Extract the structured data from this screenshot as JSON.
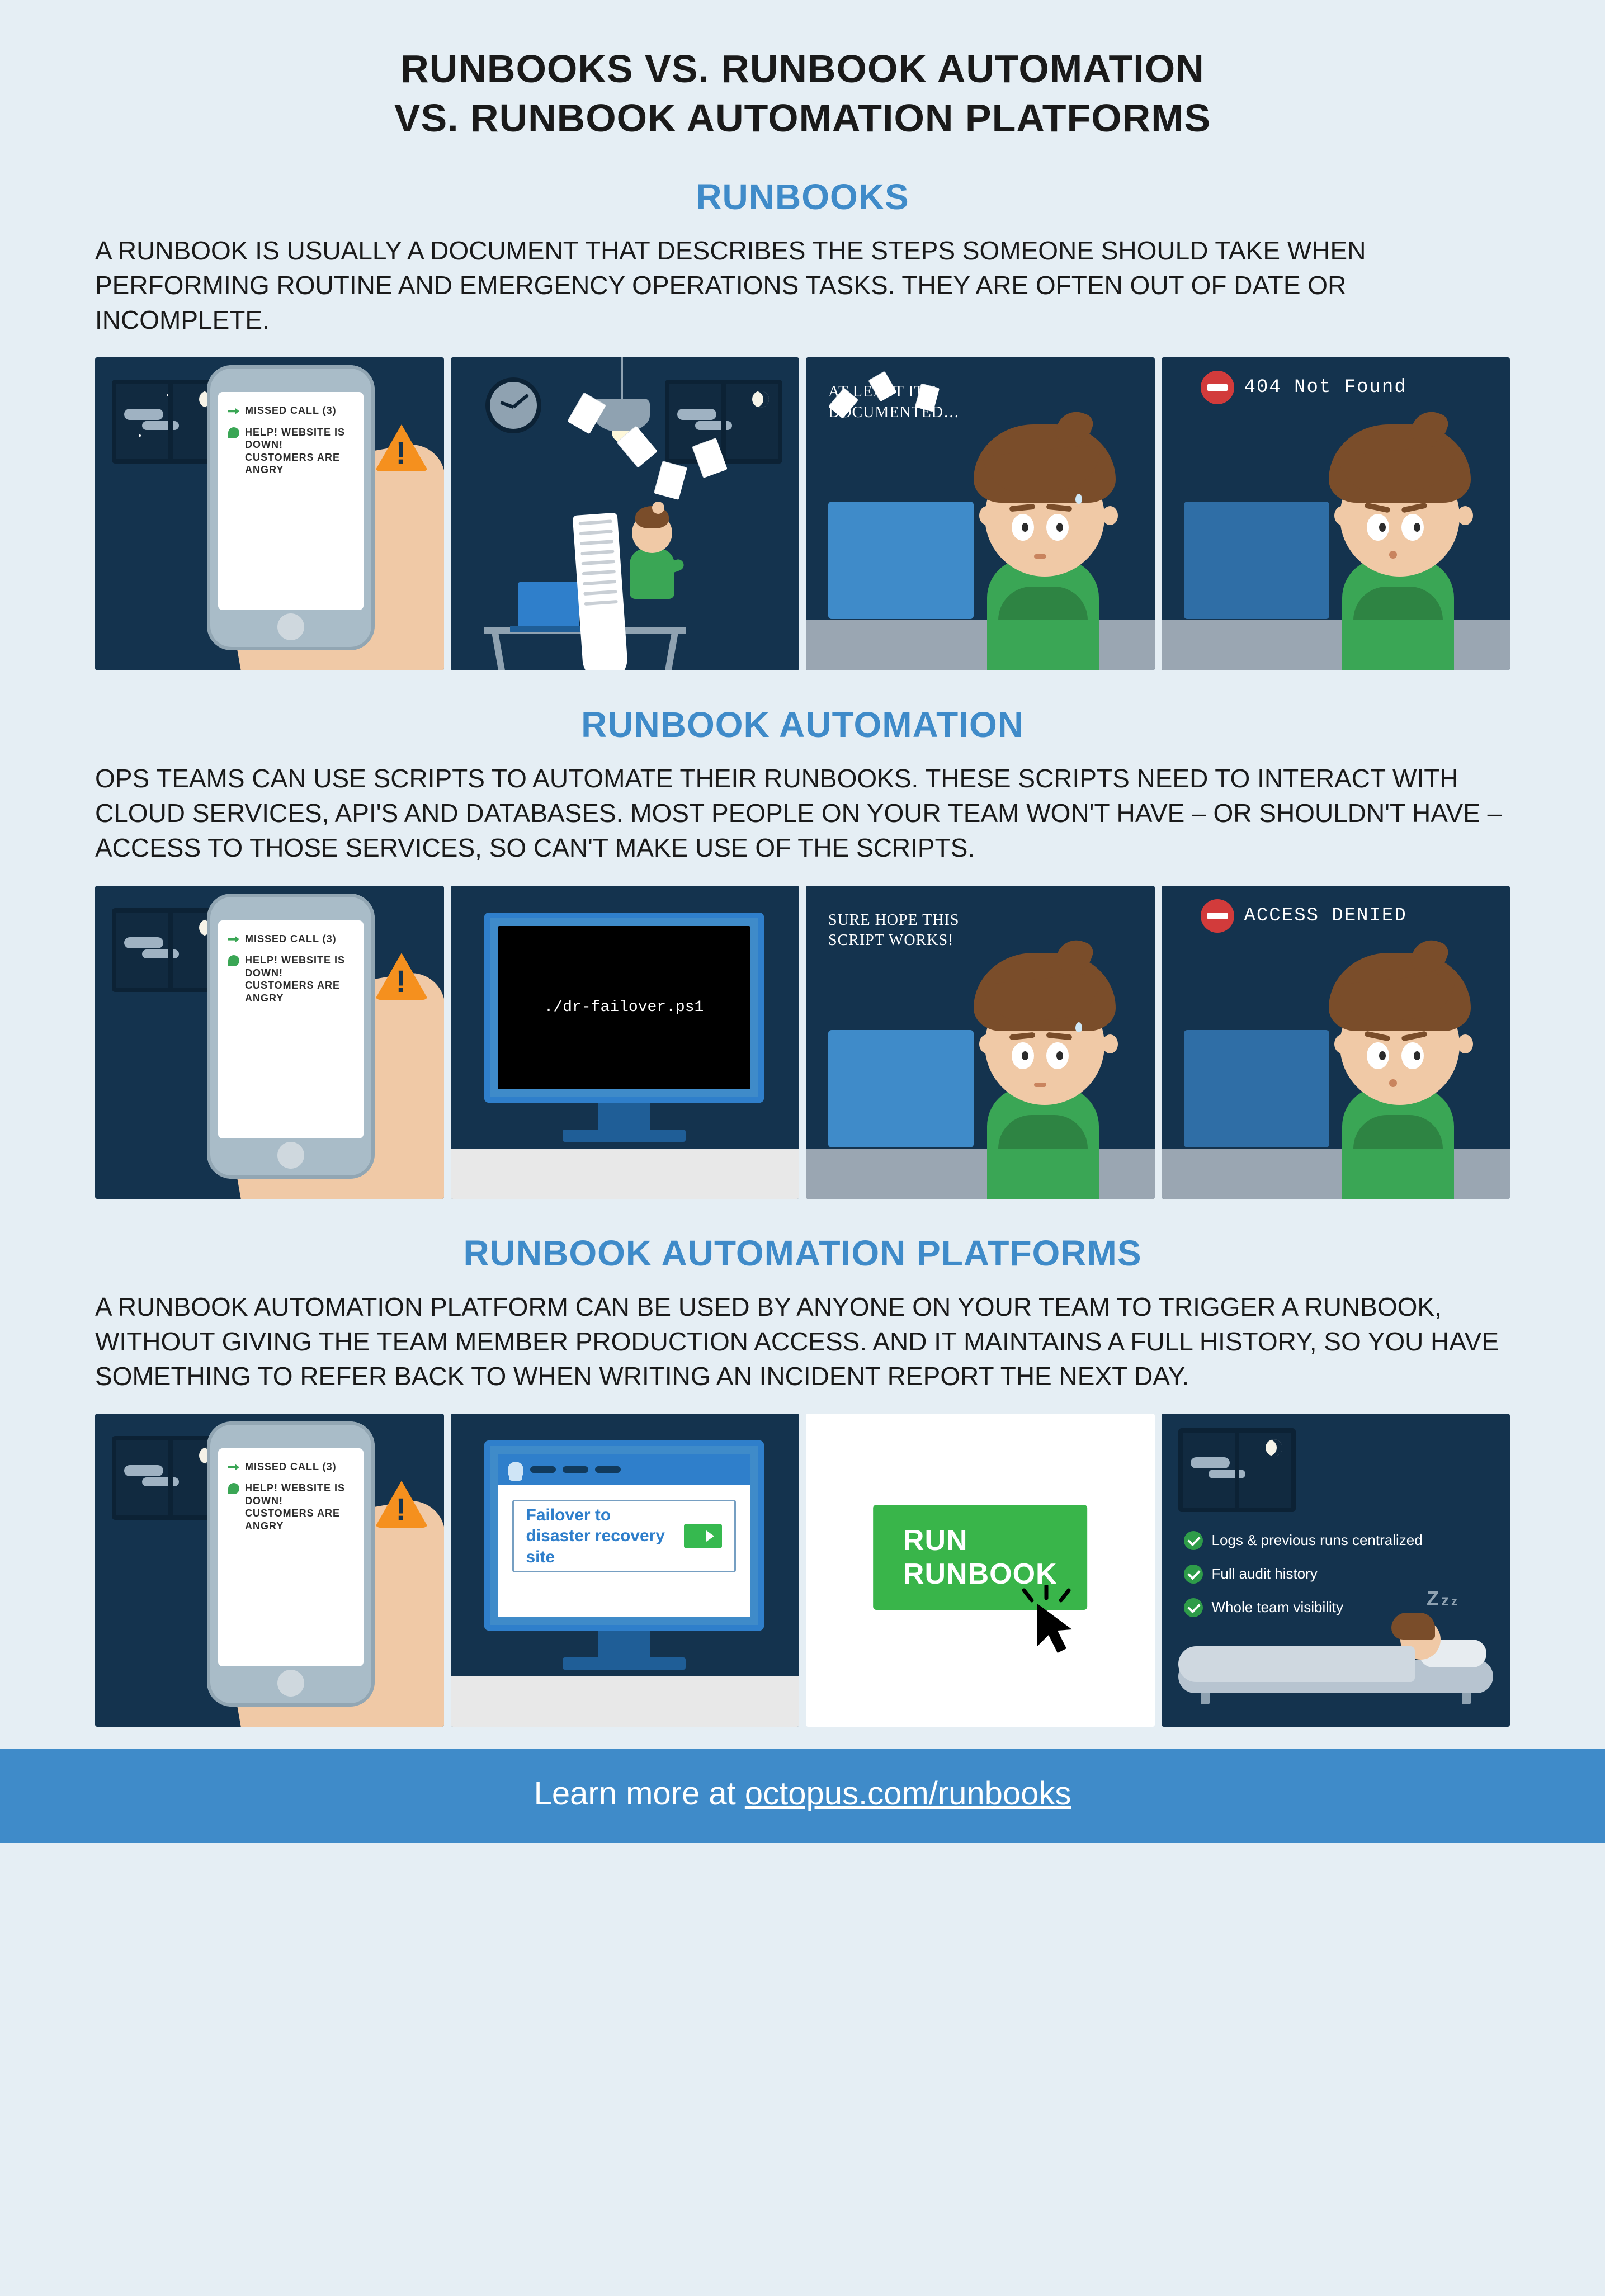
{
  "title_line1": "RUNBOOKS VS. RUNBOOK AUTOMATION",
  "title_line2": "VS. RUNBOOK AUTOMATION PLATFORMS",
  "sections": {
    "runbooks": {
      "heading": "RUNBOOKS",
      "description": "A RUNBOOK IS USUALLY A DOCUMENT THAT DESCRIBES THE STEPS SOMEONE SHOULD TAKE WHEN PERFORMING ROUTINE AND EMERGENCY OPERATIONS TASKS. THEY ARE OFTEN OUT OF DATE OR INCOMPLETE.",
      "panel_caption": "AT LEAST IT'S DOCUMENTED…",
      "error_text": "404 Not Found"
    },
    "automation": {
      "heading": "RUNBOOK AUTOMATION",
      "description": "OPS TEAMS CAN USE SCRIPTS TO AUTOMATE THEIR RUNBOOKS. THESE SCRIPTS NEED TO INTERACT WITH CLOUD SERVICES, API'S AND DATABASES. MOST PEOPLE ON YOUR TEAM WON'T HAVE – OR SHOULDN'T HAVE – ACCESS TO THOSE SERVICES, SO CAN'T MAKE USE OF THE SCRIPTS.",
      "terminal_command": "./dr-failover.ps1",
      "panel_caption": "SURE HOPE THIS SCRIPT WORKS!",
      "error_text": "ACCESS DENIED"
    },
    "platform": {
      "heading": "RUNBOOK AUTOMATION PLATFORMS",
      "description": "A RUNBOOK AUTOMATION PLATFORM CAN BE USED BY ANYONE ON YOUR TEAM TO TRIGGER A RUNBOOK, WITHOUT GIVING THE TEAM MEMBER PRODUCTION ACCESS. AND IT MAINTAINS A FULL HISTORY, SO YOU HAVE SOMETHING TO REFER BACK TO WHEN WRITING AN INCIDENT REPORT THE NEXT DAY.",
      "ui_card_text": "Failover to disaster recovery site",
      "big_button": "RUN RUNBOOK",
      "checklist": [
        "Logs & previous runs centralized",
        "Full audit history",
        "Whole team visibility"
      ]
    }
  },
  "phone": {
    "missed_call": "MISSED CALL (3)",
    "help_msg": "HELP! WEBSITE IS DOWN! CUSTOMERS ARE ANGRY"
  },
  "footer": {
    "prefix": "Learn more at ",
    "link_text": "octopus.com/runbooks"
  }
}
